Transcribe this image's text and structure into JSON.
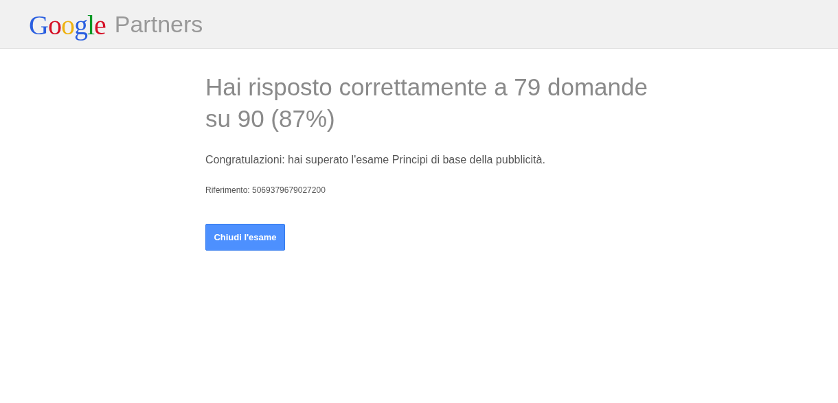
{
  "header": {
    "logo": "Google",
    "product": "Partners"
  },
  "result": {
    "heading": "Hai risposto correttamente a 79 domande su 90 (87%)",
    "message": "Congratulazioni: hai superato l'esame Principi di base della pubblicità.",
    "reference": "Riferimento: 5069379679027200",
    "button": "Chiudi l'esame"
  }
}
